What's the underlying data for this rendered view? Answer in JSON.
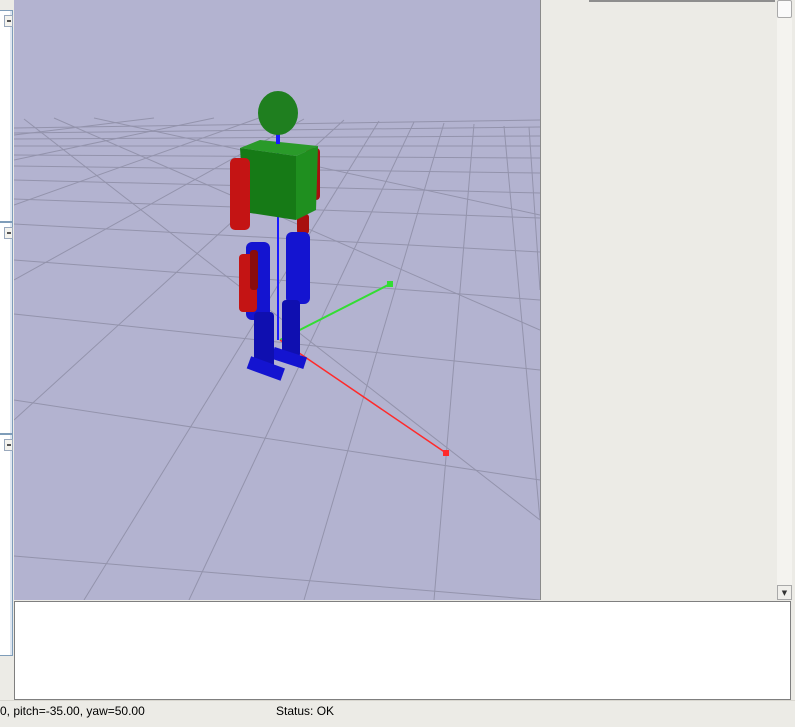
{
  "window": {
    "background": "#ecebe6"
  },
  "viewport": {
    "background": "#b3b3d0",
    "colors": {
      "head": "#1f7f1f",
      "torso": "#1b8a1b",
      "arm": "#c41414",
      "leg": "#1414d0",
      "axis_x": "#ff2a2a",
      "axis_y": "#33dd33",
      "axis_z": "#1a1aff",
      "grid": "#8e8ea6"
    }
  },
  "status_bar": {
    "camera": "0, pitch=-35.00, yaw=50.00",
    "status": "Status: OK"
  },
  "icons": {
    "scroll_up": "arrow-up-icon",
    "scroll_down": "arrow-down-icon"
  }
}
